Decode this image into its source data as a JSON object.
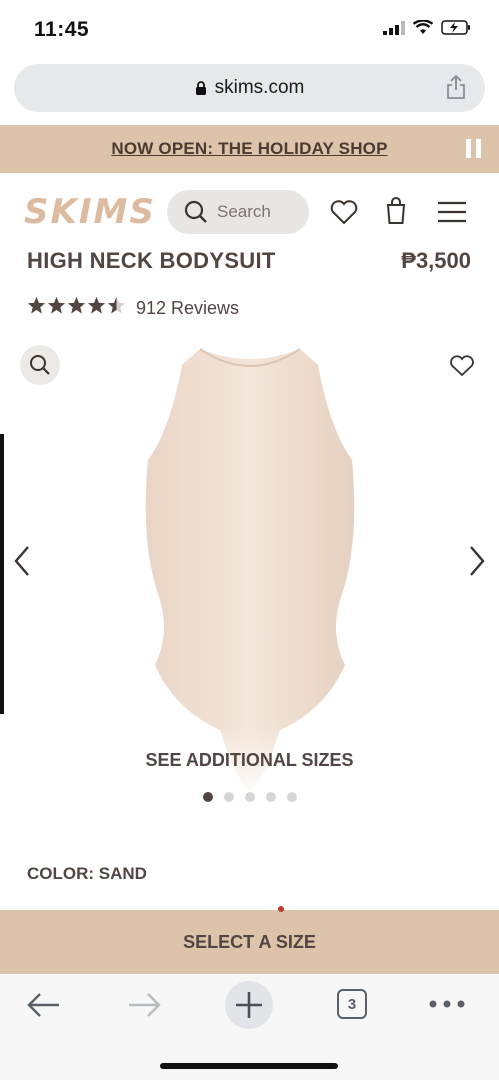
{
  "status_bar": {
    "time": "11:45"
  },
  "browser": {
    "url": "skims.com",
    "tab_count": "3"
  },
  "banner": {
    "text": "NOW OPEN: THE HOLIDAY SHOP"
  },
  "header": {
    "logo": "SKIMS",
    "search_placeholder": "Search"
  },
  "product": {
    "title": "HIGH NECK BODYSUIT",
    "price": "₱3,500",
    "rating": 4.5,
    "reviews": "912 Reviews",
    "see_sizes": "SEE ADDITIONAL SIZES",
    "image_count": 5,
    "active_image": 1,
    "color_label": "COLOR: SAND",
    "product_color": "#f0dfd2"
  },
  "cta": {
    "label": "SELECT A SIZE"
  },
  "colors": {
    "accent": "#dcc3aa",
    "text": "#524642"
  }
}
